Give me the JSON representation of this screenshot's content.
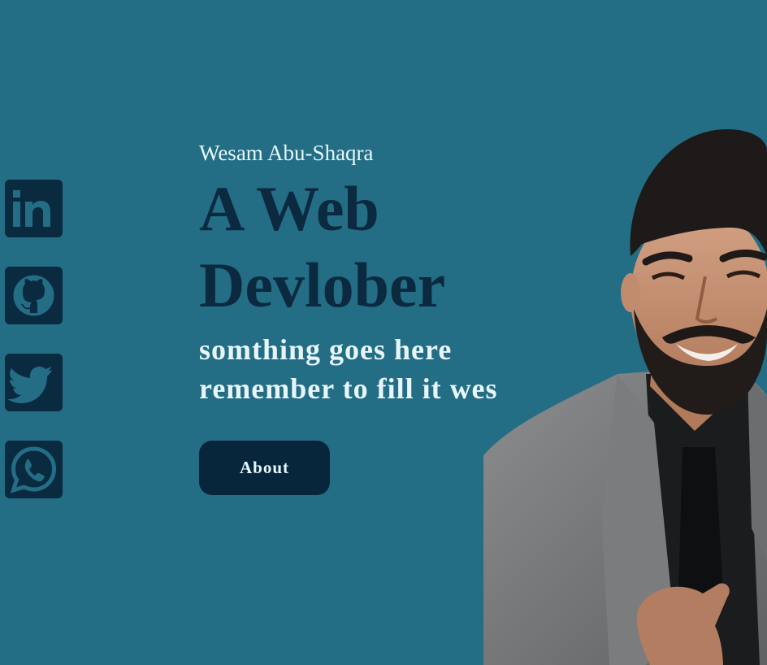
{
  "hero": {
    "name": "Wesam Abu-Shaqra",
    "headline_line1": "A Web",
    "headline_line2": "Devlober",
    "tagline_line1": "somthing goes here",
    "tagline_line2": "remember to fill it wes",
    "about_label": "About"
  },
  "social": {
    "items": [
      {
        "name": "linkedin-icon"
      },
      {
        "name": "github-icon"
      },
      {
        "name": "twitter-icon"
      },
      {
        "name": "whatsapp-icon"
      }
    ]
  },
  "colors": {
    "background": "#236d85",
    "icon_dark": "#0a2a40",
    "headline": "#0b2a40",
    "text_light": "#e8f7ff",
    "button": "#07263c"
  }
}
